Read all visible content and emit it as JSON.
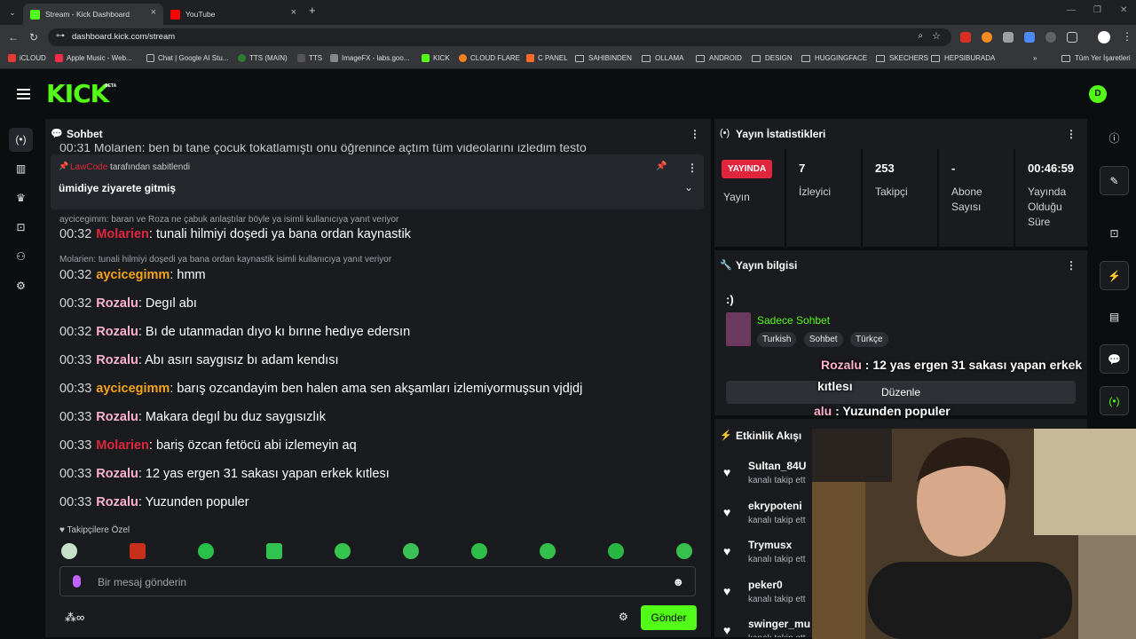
{
  "browser": {
    "tabs": [
      {
        "title": "Stream - Kick Dashboard",
        "color": "#53fc18"
      },
      {
        "title": "YouTube",
        "color": "#ff0000"
      }
    ],
    "url": "dashboard.kick.com/stream",
    "bookmarks": [
      "iCLOUD",
      "Apple Music - Web...",
      "Chat | Google AI Stu...",
      "TTS (MAIN)",
      "TTS",
      "ImageFX - labs.goo...",
      "KICK",
      "CLOUD FLARE",
      "C PANEL",
      "SAHIBINDEN",
      "OLLAMA",
      "ANDROID",
      "DESIGN",
      "HUGGINGFACE",
      "SKECHERS",
      "HEPSIBURADA"
    ],
    "all_bookmarks": "Tüm Yer İşaretleri"
  },
  "app": {
    "logo": "KICK",
    "beta": "BETA",
    "avatar": "D"
  },
  "chat": {
    "title": "Sohbet",
    "cut_line": "00:31 Molarien: ben bi tane çocuk tokatlamıştı onu öğrenince açtım tüm videolarını izledim testo",
    "pinned_by_user": "LawCode",
    "pinned_by_suffix": "tarafından sabitlendi",
    "pinned_message": "ümidiye ziyarete gitmiş",
    "messages": [
      {
        "reply": "aycicegimm: baran ve Roza ne çabuk anlaştılar böyle ya isimli kullanıcıya yanıt veriyor",
        "time": "00:32",
        "user": "Molarien",
        "color": "#e0263e",
        "text": ": tunali hilmiyi doşedi ya bana ordan kaynastik"
      },
      {
        "reply": "Molarien: tunali hilmiyi doşedi ya bana ordan kaynastik isimli kullanıcıya yanıt veriyor",
        "time": "00:32",
        "user": "aycicegimm",
        "color": "#f5a31a",
        "text": ": hmm"
      },
      {
        "time": "00:32",
        "user": "Rozalu",
        "color": "#ffb3cb",
        "text": ": Degıl abı"
      },
      {
        "time": "00:32",
        "user": "Rozalu",
        "color": "#ffb3cb",
        "text": ": Bı de utanmadan dıyo kı bırıne hedıye edersın"
      },
      {
        "time": "00:33",
        "user": "Rozalu",
        "color": "#ffb3cb",
        "text": ": Abı asırı saygısız bı adam kendısı"
      },
      {
        "time": "00:33",
        "user": "aycicegimm",
        "color": "#f5a31a",
        "text": ": barış ozcandayim ben halen ama sen akşamları izlemiyormuşsun vjdjdj"
      },
      {
        "time": "00:33",
        "user": "Rozalu",
        "color": "#ffb3cb",
        "text": ": Makara degıl bu duz saygısızlık"
      },
      {
        "time": "00:33",
        "user": "Molarien",
        "color": "#e0263e",
        "text": ": bariş özcan fetöcü abi izlemeyin aq"
      },
      {
        "time": "00:33",
        "user": "Rozalu",
        "color": "#ffb3cb",
        "text": ": 12 yas ergen 31 sakası yapan erkek kıtlesı"
      },
      {
        "time": "00:33",
        "user": "Rozalu",
        "color": "#ffb3cb",
        "text": ": Yuzunden populer"
      }
    ],
    "followers_only": "Takipçilere Özel",
    "input_placeholder": "Bir mesaj gönderin",
    "send": "Gönder"
  },
  "stats": {
    "title": "Yayın İstatistikleri",
    "live_badge": "YAYINDA",
    "items": [
      {
        "value": "",
        "label": "Yayın"
      },
      {
        "value": "7",
        "label": "İzleyici"
      },
      {
        "value": "253",
        "label": "Takipçi"
      },
      {
        "value": "-",
        "label": "Abone Sayısı"
      },
      {
        "value": "00:46:59",
        "label": "Yayında Olduğu Süre"
      }
    ]
  },
  "info": {
    "title": "Yayın bilgisi",
    "stream_title": ":)",
    "category": "Sadece Sohbet",
    "tags": [
      "Turkish",
      "Sohbet",
      "Türkçe"
    ],
    "edit": "Düzenle"
  },
  "activity": {
    "title": "Etkinlik Akışı",
    "items": [
      {
        "name": "Sultan_84U",
        "sub": "kanalı takip ett"
      },
      {
        "name": "ekrypoteni",
        "sub": "kanalı takip ett"
      },
      {
        "name": "Trymusx",
        "sub": "kanalı takip ett"
      },
      {
        "name": "peker0",
        "sub": "kanalı takip ett"
      },
      {
        "name": "swinger_mu",
        "sub": "kanalı takip ett"
      }
    ]
  },
  "overlay": {
    "l1_name": "Rozalu",
    "l1_text": " : 12 yas ergen 31 sakası yapan erkek",
    "l2_text": "kıtlesı",
    "l3_name": "alu",
    "l3_text": " : Yuzunden populer"
  }
}
